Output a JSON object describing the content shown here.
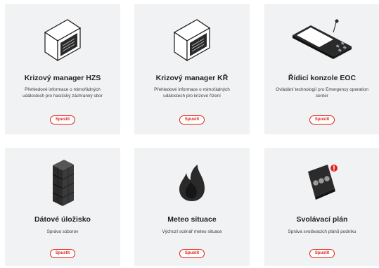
{
  "cards": [
    {
      "icon": "monitor-icon",
      "title": "Krizový manager HZS",
      "description_line1": "Přehledové informace o mimořádných",
      "description_line2": "událostech pro hasičský záchranný sbor",
      "button_label": "Spustit"
    },
    {
      "icon": "monitor-icon",
      "title": "Krizový manager KŘ",
      "description_line1": "Přehledové informace o mimořádných",
      "description_line2": "událostech pro krizové řízení",
      "button_label": "Spustit"
    },
    {
      "icon": "control-console-icon",
      "title": "Řídicí konzole EOC",
      "description_line1": "Ovládání technologií pro Emergency operation",
      "description_line2": "center",
      "button_label": "Spustit"
    },
    {
      "icon": "server-storage-icon",
      "title": "Dátové úložisko",
      "description_line1": "Správa súborov",
      "description_line2": "",
      "button_label": "Spustit"
    },
    {
      "icon": "fire-icon",
      "title": "Meteo situace",
      "description_line1": "Výchozí scénář meteo situace",
      "description_line2": "",
      "button_label": "Spustit"
    },
    {
      "icon": "alarm-device-icon",
      "title": "Svolávací plán",
      "description_line1": "Správa svolávacích plánů podniku",
      "description_line2": "",
      "button_label": "Spustit"
    }
  ],
  "colors": {
    "card_background": "#f1f2f4",
    "accent": "#e2231a",
    "title": "#222222",
    "text": "#3c3c3c"
  }
}
